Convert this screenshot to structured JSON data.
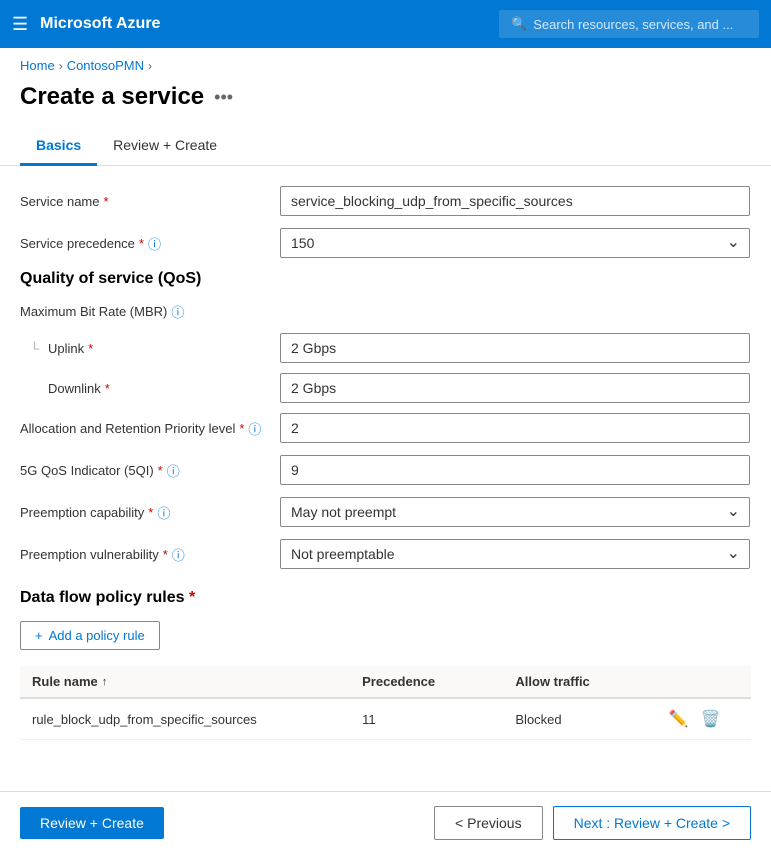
{
  "topbar": {
    "hamburger": "☰",
    "title": "Microsoft Azure",
    "search_placeholder": "Search resources, services, and ..."
  },
  "breadcrumb": {
    "home": "Home",
    "parent": "ContosoPMN",
    "sep": "›"
  },
  "page": {
    "title": "Create a service",
    "options_icon": "•••"
  },
  "tabs": [
    {
      "id": "basics",
      "label": "Basics",
      "active": true
    },
    {
      "id": "review",
      "label": "Review + Create",
      "active": false
    }
  ],
  "form": {
    "service_name_label": "Service name",
    "service_name_value": "service_blocking_udp_from_specific_sources",
    "service_precedence_label": "Service precedence",
    "service_precedence_value": "150",
    "qos_section_title": "Quality of service (QoS)",
    "mbr_label": "Maximum Bit Rate (MBR)",
    "uplink_label": "Uplink",
    "uplink_value": "2 Gbps",
    "downlink_label": "Downlink",
    "downlink_value": "2 Gbps",
    "alloc_label": "Allocation and Retention Priority level",
    "alloc_value": "2",
    "qos_indicator_label": "5G QoS Indicator (5QI)",
    "qos_indicator_value": "9",
    "preemption_cap_label": "Preemption capability",
    "preemption_cap_value": "May not preempt",
    "preemption_vuln_label": "Preemption vulnerability",
    "preemption_vuln_value": "Not preemptable",
    "required_star": "*",
    "info_icon": "ⓘ"
  },
  "policy_rules": {
    "section_title": "Data flow policy rules",
    "required_star": "*",
    "add_button_label": "Add a policy rule",
    "add_icon": "+",
    "table": {
      "col_name": "Rule name",
      "col_precedence": "Precedence",
      "col_traffic": "Allow traffic",
      "sort_arrow": "↑",
      "rows": [
        {
          "rule_name": "rule_block_udp_from_specific_sources",
          "precedence": "11",
          "allow_traffic": "Blocked"
        }
      ]
    }
  },
  "bottom_bar": {
    "review_create_label": "Review + Create",
    "previous_label": "< Previous",
    "next_label": "Next : Review + Create >"
  }
}
